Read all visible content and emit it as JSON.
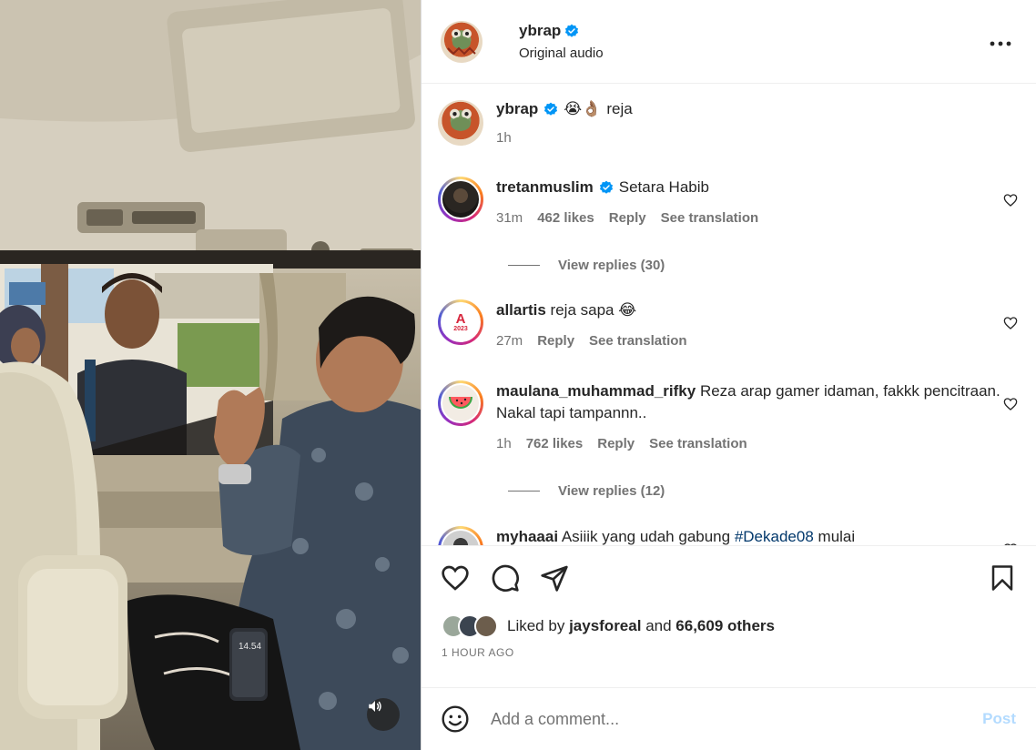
{
  "header": {
    "username": "ybrap",
    "subtitle": "Original audio",
    "avatar_icon": "frog-avatar",
    "more_icon": "more-options-icon"
  },
  "caption": {
    "username": "ybrap",
    "emoji": "😭👌🏽",
    "text": "reja",
    "time": "1h"
  },
  "comments": [
    {
      "username": "tretanmuslim",
      "verified": true,
      "text": "Setara Habib",
      "time": "31m",
      "likes": "462 likes",
      "reply": "Reply",
      "translate": "See translation",
      "view_replies": "View replies (30)"
    },
    {
      "username": "allartis",
      "verified": false,
      "text": "reja sapa 😂",
      "time": "27m",
      "reply": "Reply",
      "translate": "See translation",
      "avatar_label": "A",
      "avatar_year": "2023"
    },
    {
      "username": "maulana_muhammad_rifky",
      "verified": false,
      "text": "Reza arap gamer idaman, fakkk pencitraan. Nakal tapi tampannn..",
      "time": "1h",
      "likes": "762 likes",
      "reply": "Reply",
      "translate": "See translation",
      "view_replies": "View replies (12)"
    },
    {
      "username": "myhaaai",
      "verified": false,
      "text": "Asiiik yang udah gabung",
      "hashtag": "#Dekade08",
      "text_after": "mulai"
    }
  ],
  "actions": {
    "liked_by_prefix": "Liked by",
    "liked_by_user": "jaysforeal",
    "liked_by_and": "and",
    "liked_by_others": "66,609 others",
    "timestamp": "1 HOUR AGO"
  },
  "add_comment": {
    "placeholder": "Add a comment...",
    "post_label": "Post"
  },
  "media": {
    "phone_time": "14.54"
  },
  "colors": {
    "verified_blue": "#0095f6",
    "secondary_text": "#737373",
    "post_disabled": "#b3dbff",
    "hashtag": "#00376b"
  }
}
